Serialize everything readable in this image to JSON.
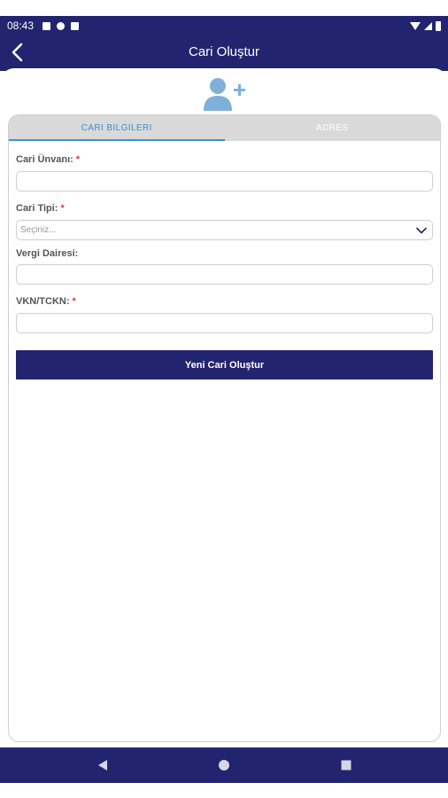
{
  "status_bar": {
    "time": "08:43"
  },
  "header": {
    "title": "Cari Oluştur"
  },
  "tabs": [
    {
      "label": "CARI BILGILERI",
      "active": true
    },
    {
      "label": "ADRES",
      "active": false
    }
  ],
  "form": {
    "fields": [
      {
        "label": "Cari Ünvanı:",
        "required_mark": "*",
        "value": ""
      },
      {
        "label": "Cari Tipi:",
        "required_mark": "*",
        "placeholder": "Seçiniz..."
      },
      {
        "label": "Vergi Dairesi:",
        "required_mark": "",
        "value": ""
      },
      {
        "label": "VKN/TCKN:",
        "required_mark": "*",
        "value": ""
      }
    ],
    "submit_label": "Yeni Cari Oluştur"
  },
  "colors": {
    "primary": "#23246f",
    "accent": "#3b8fd6",
    "required": "#e23a3a",
    "icon": "#7fb0d9"
  },
  "icons": {
    "back": "chevron-left-icon",
    "add_user": "add-user-icon",
    "dropdown": "chevron-down-icon"
  }
}
